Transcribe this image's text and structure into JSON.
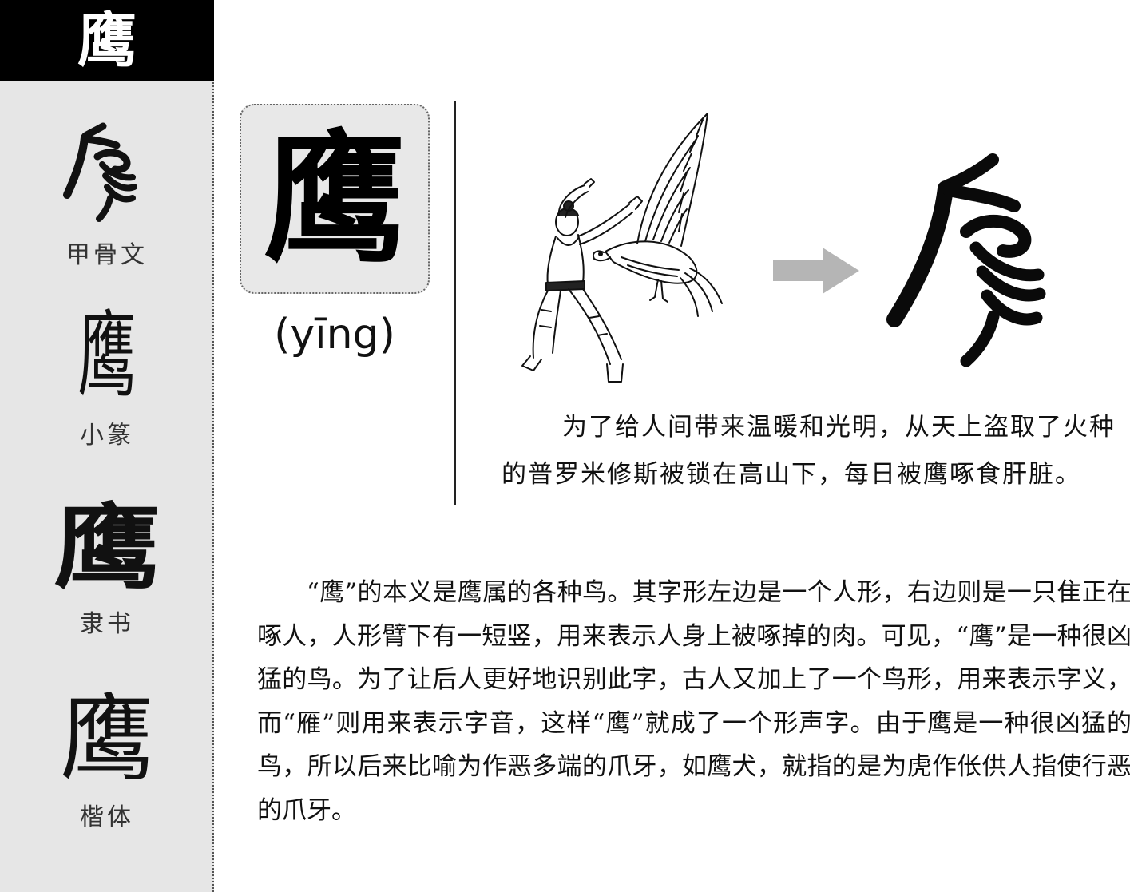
{
  "sidebar": {
    "header_char": "鹰",
    "scripts": [
      {
        "name": "oracle",
        "label": "甲骨文"
      },
      {
        "name": "seal",
        "glyph": "鹰",
        "label": "小篆"
      },
      {
        "name": "clerical",
        "glyph": "鹰",
        "label": "隶书"
      },
      {
        "name": "regular",
        "glyph": "鹰",
        "label": "楷体"
      }
    ]
  },
  "main": {
    "char": "鹰",
    "pinyin": "(yīng)",
    "caption": "为了给人间带来温暖和光明，从天上盗取了火种的普罗米修斯被锁在高山下，每日被鹰啄食肝脏。",
    "body": "“鹰”的本义是鹰属的各种鸟。其字形左边是一个人形，右边则是一只隹正在啄人，人形臂下有一短竖，用来表示人身上被啄掉的肉。可见，“鹰”是一种很凶猛的鸟。为了让后人更好地识别此字，古人又加上了一个鸟形，用来表示字义，而“雁”则用来表示字音，这样“鹰”就成了一个形声字。由于鹰是一种很凶猛的鸟，所以后来比喻为作恶多端的爪牙，如鹰犬，就指的是为虎作伥供人指使行恶的爪牙。"
  },
  "colors": {
    "sidebar_bg": "#e6e6e6",
    "header_bg": "#000000",
    "card_bg": "#e8e8e8",
    "arrow": "#b5b5b5"
  },
  "icons": {
    "arrow": "arrow-right-icon",
    "illustration": "prometheus-eagle-illustration",
    "oracle": "oracle-bone-glyph"
  }
}
